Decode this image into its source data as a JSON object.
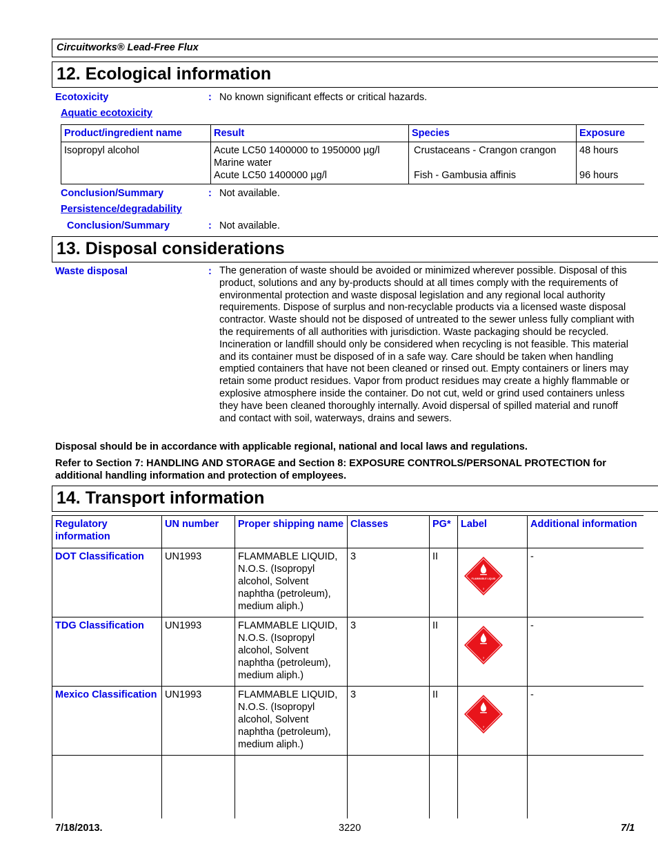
{
  "header": {
    "product_name": "Circuitworks® Lead-Free Flux"
  },
  "section12": {
    "title": "12. Ecological information",
    "ecotoxicity": {
      "label": "Ecotoxicity",
      "value": "No known significant effects or critical hazards."
    },
    "aquatic_link": "Aquatic ecotoxicity",
    "table": {
      "columns": [
        "Product/ingredient name",
        "Result",
        "Species",
        "Exposure"
      ],
      "rows": [
        {
          "name": "Isopropyl alcohol",
          "result_lines": [
            "Acute LC50 1400000 to 1950000 µg/l",
            "Marine water",
            "Acute LC50 1400000 µg/l"
          ],
          "species_lines": [
            "Crustaceans - Crangon crangon",
            "",
            "Fish - Gambusia affinis"
          ],
          "exposure_lines": [
            "48 hours",
            "",
            "96 hours"
          ]
        }
      ]
    },
    "conclusion1": {
      "label": "Conclusion/Summary",
      "value": "Not available."
    },
    "persistence_link": "Persistence/degradability",
    "conclusion2": {
      "label": "Conclusion/Summary",
      "value": "Not available."
    }
  },
  "section13": {
    "title": "13. Disposal considerations",
    "waste_disposal": {
      "label": "Waste disposal",
      "value": "The generation of waste should be avoided or minimized wherever possible.  Disposal of this product, solutions and any by-products should at all times comply with the requirements of environmental protection and waste disposal legislation and any regional local authority requirements.  Dispose of surplus and non-recyclable products via a licensed waste disposal contractor.  Waste should not be disposed of untreated to the sewer unless fully compliant with the requirements of all authorities with jurisdiction. Waste packaging should be recycled.  Incineration or landfill should only be considered when recycling is not feasible.  This material and its container must be disposed of in a safe way.  Care should be taken when handling emptied containers that have not been cleaned or rinsed out.  Empty containers or liners may retain some product residues. Vapor from product residues may create a highly flammable or explosive atmosphere inside the container.  Do not cut, weld or grind used containers unless they have been cleaned thoroughly internally.  Avoid dispersal of spilled material and runoff and contact with soil, waterways, drains and sewers."
    },
    "note1": "Disposal should be in accordance with applicable regional, national and local laws and regulations.",
    "note2": "Refer to Section 7: HANDLING AND STORAGE and Section 8: EXPOSURE CONTROLS/PERSONAL PROTECTION for additional handling information and protection of employees."
  },
  "section14": {
    "title": "14. Transport information",
    "columns": [
      "Regulatory information",
      "UN number",
      "Proper shipping name",
      "Classes",
      "PG*",
      "Label",
      "Additional information"
    ],
    "rows": [
      {
        "regulatory": "DOT Classification",
        "un": "UN1993",
        "shipping_name": "FLAMMABLE LIQUID, N.O.S. (Isopropyl alcohol, Solvent naphtha (petroleum), medium aliph.)",
        "classes": "3",
        "pg": "II",
        "label_icon": "flammable-liquid-placard",
        "label_text": "FLAMMABLE LIQUID",
        "additional": "-"
      },
      {
        "regulatory": "TDG Classification",
        "un": "UN1993",
        "shipping_name": "FLAMMABLE LIQUID, N.O.S. (Isopropyl alcohol, Solvent naphtha (petroleum), medium aliph.)",
        "classes": "3",
        "pg": "II",
        "label_icon": "flammable-liquid-placard",
        "label_text": "",
        "additional": "-"
      },
      {
        "regulatory": "Mexico Classification",
        "un": "UN1993",
        "shipping_name": "FLAMMABLE LIQUID, N.O.S. (Isopropyl alcohol, Solvent naphtha (petroleum), medium aliph.)",
        "classes": "3",
        "pg": "II",
        "label_icon": "flammable-liquid-placard",
        "label_text": "",
        "additional": "-"
      }
    ],
    "placard_color": "#e8141b"
  },
  "footer": {
    "left": "7/18/2013.",
    "center": "3220",
    "right": "7/1"
  },
  "colors": {
    "label_blue": "#0000e6",
    "text": "#000000"
  }
}
